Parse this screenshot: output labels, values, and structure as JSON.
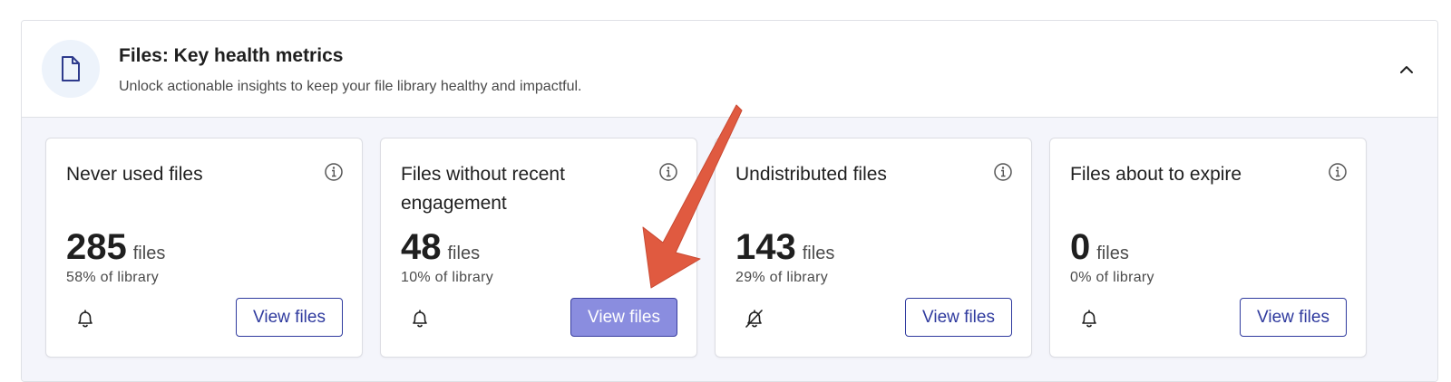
{
  "header": {
    "title": "Files: Key health metrics",
    "subtitle": "Unlock actionable insights to keep your file library healthy and impactful.",
    "icon": "file-icon",
    "collapse_icon": "chevron-up-icon"
  },
  "cards": [
    {
      "title": "Never used files",
      "value": "285",
      "unit": "files",
      "percent": "58% of library",
      "bell": "bell-icon",
      "button": "View files"
    },
    {
      "title": "Files without recent engagement",
      "value": "48",
      "unit": "files",
      "percent": "10% of library",
      "bell": "bell-icon",
      "button": "View files"
    },
    {
      "title": "Undistributed files",
      "value": "143",
      "unit": "files",
      "percent": "29% of library",
      "bell": "bell-off-icon",
      "button": "View files"
    },
    {
      "title": "Files about to expire",
      "value": "0",
      "unit": "files",
      "percent": "0% of library",
      "bell": "bell-icon",
      "button": "View files"
    }
  ],
  "colors": {
    "accent": "#2f3a9e",
    "active_button": "#8a8ddf",
    "body_bg": "#f4f5fb",
    "annotation_arrow": "#e05a40"
  }
}
